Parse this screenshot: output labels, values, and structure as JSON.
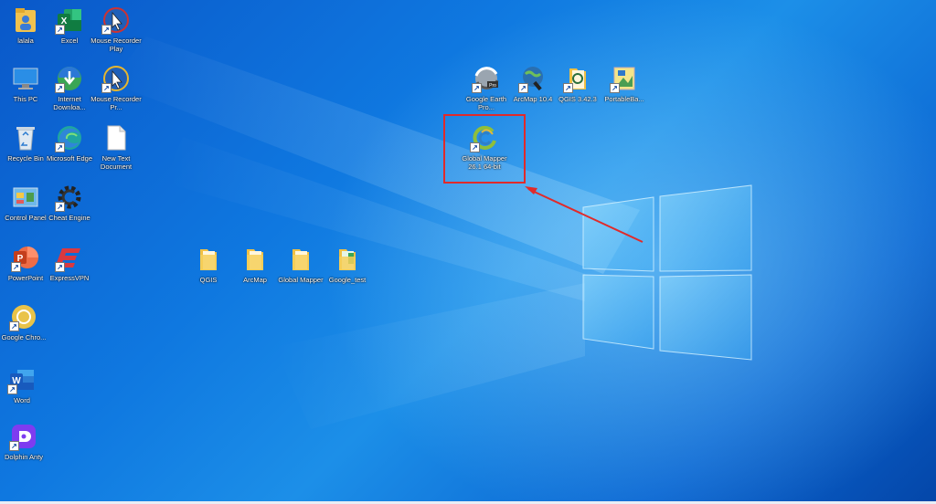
{
  "desktop": {
    "icons": [
      {
        "id": "lalala",
        "label": "lalala",
        "kind": "user-folder",
        "shortcut": false
      },
      {
        "id": "excel",
        "label": "Excel",
        "kind": "excel",
        "shortcut": true
      },
      {
        "id": "mouse-recorder-play",
        "label": "Mouse Recorder Play",
        "kind": "mouse-recorder",
        "shortcut": true
      },
      {
        "id": "this-pc",
        "label": "This PC",
        "kind": "pc",
        "shortcut": false
      },
      {
        "id": "internet-download",
        "label": "Internet Downloa...",
        "kind": "idm",
        "shortcut": true
      },
      {
        "id": "mouse-recorder-pro",
        "label": "Mouse Recorder Pr...",
        "kind": "mouse-recorder",
        "shortcut": true
      },
      {
        "id": "recycle-bin",
        "label": "Recycle Bin",
        "kind": "recycle",
        "shortcut": false
      },
      {
        "id": "microsoft-edge",
        "label": "Microsoft Edge",
        "kind": "edge",
        "shortcut": true
      },
      {
        "id": "new-text-document",
        "label": "New Text Document",
        "kind": "textdoc",
        "shortcut": false
      },
      {
        "id": "control-panel",
        "label": "Control Panel",
        "kind": "control-panel",
        "shortcut": false
      },
      {
        "id": "cheat-engine",
        "label": "Cheat Engine",
        "kind": "cheat-engine",
        "shortcut": true
      },
      {
        "id": "powerpoint",
        "label": "PowerPoint",
        "kind": "powerpoint",
        "shortcut": true
      },
      {
        "id": "expressvpn",
        "label": "ExpressVPN",
        "kind": "expressvpn",
        "shortcut": true
      },
      {
        "id": "google-chrome",
        "label": "Google Chro...",
        "kind": "chrome",
        "shortcut": true
      },
      {
        "id": "word",
        "label": "Word",
        "kind": "word",
        "shortcut": true
      },
      {
        "id": "dolphin-anty",
        "label": "Dolphin Anty",
        "kind": "dolphin",
        "shortcut": true
      },
      {
        "id": "qgis-folder",
        "label": "QGIS",
        "kind": "folder",
        "shortcut": false
      },
      {
        "id": "arcmap-folder",
        "label": "ArcMap",
        "kind": "folder",
        "shortcut": false
      },
      {
        "id": "global-mapper-folder",
        "label": "Global Mapper",
        "kind": "folder",
        "shortcut": false
      },
      {
        "id": "google-test-folder",
        "label": "Google_test",
        "kind": "folder-green",
        "shortcut": false
      },
      {
        "id": "google-earth-pro",
        "label": "Google Earth Pro...",
        "kind": "earth",
        "shortcut": true
      },
      {
        "id": "arcmap-104",
        "label": "ArcMap 10.4",
        "kind": "arcmap",
        "shortcut": true
      },
      {
        "id": "qgis-3423",
        "label": "QGIS 3.42.3",
        "kind": "qgis",
        "shortcut": true
      },
      {
        "id": "portable-base",
        "label": "PortableBa...",
        "kind": "portable",
        "shortcut": true
      },
      {
        "id": "global-mapper-261",
        "label": "Global Mapper 26.1 64-bit",
        "kind": "globalmapper",
        "shortcut": true
      }
    ],
    "highlighted_icon": "global-mapper-261",
    "colors": {
      "annotation": "#e12a2a",
      "background": "#0f78e0"
    }
  }
}
